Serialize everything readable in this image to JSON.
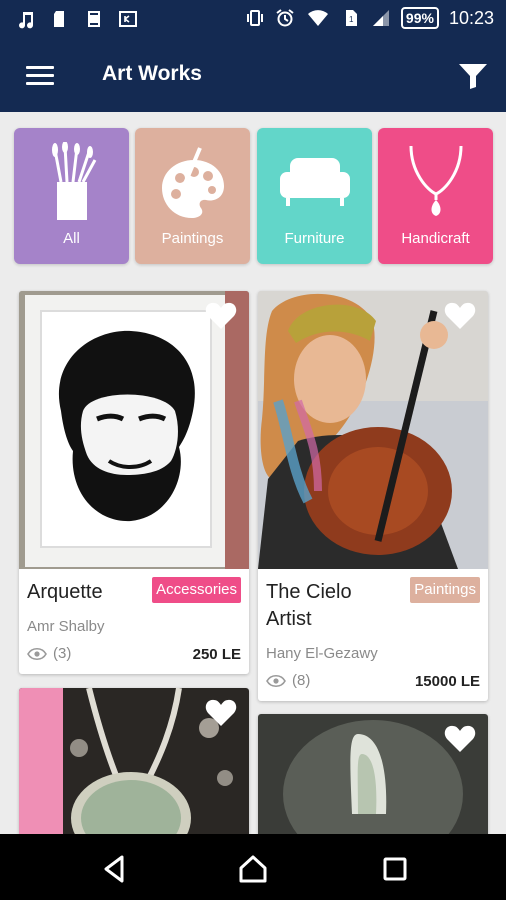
{
  "status_bar": {
    "left_icons": [
      "music-icon",
      "sd-card-icon",
      "app-s-icon",
      "app-k-icon"
    ],
    "right_icons": [
      "vibrate-icon",
      "alarm-icon",
      "wifi-icon",
      "sim-icon",
      "signal-icon"
    ],
    "battery": "99%",
    "time": "10:23"
  },
  "app_bar": {
    "title": "Art Works",
    "menu_icon": "hamburger-menu-icon",
    "filter_icon": "filter-icon"
  },
  "categories": [
    {
      "label": "All",
      "icon": "brushes-icon",
      "color": "#a583c9"
    },
    {
      "label": "Paintings",
      "icon": "palette-icon",
      "color": "#ddb09e"
    },
    {
      "label": "Furniture",
      "icon": "sofa-icon",
      "color": "#62d6c9"
    },
    {
      "label": "Handicraft",
      "icon": "necklace-icon",
      "color": "#ef4d88"
    }
  ],
  "products": [
    {
      "name": "Arquette",
      "category": "Accessories",
      "category_color": "#ef4d88",
      "artist": "Amr Shalby",
      "views": "(3)",
      "price": "250 LE"
    },
    {
      "name": "The Cielo Artist",
      "category": "Paintings",
      "category_color": "#ddb09e",
      "artist": "Hany El-Gezawy",
      "views": "(8)",
      "price": "15000 LE"
    },
    {
      "name": "",
      "category": "",
      "artist": "",
      "views": "",
      "price": ""
    },
    {
      "name": "",
      "category": "",
      "artist": "",
      "views": "",
      "price": ""
    }
  ],
  "nav_bar": {
    "back": "back-icon",
    "home": "home-icon",
    "recents": "recents-icon"
  }
}
